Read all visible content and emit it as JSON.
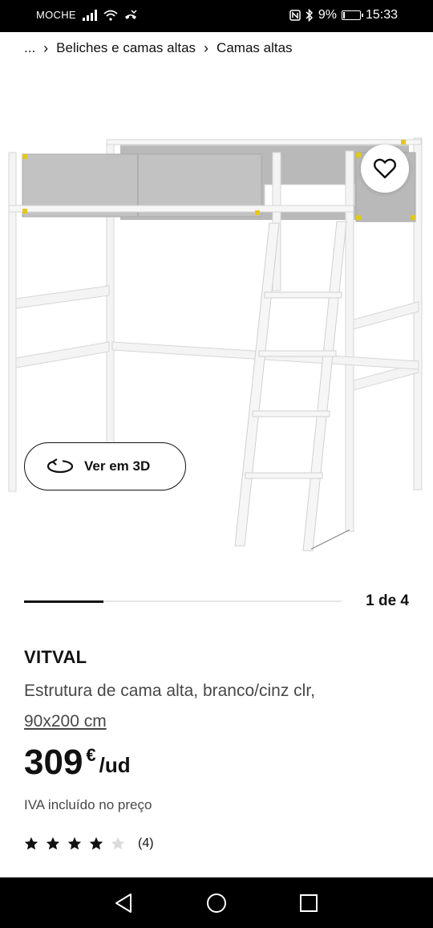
{
  "status_bar": {
    "carrier": "MOCHE",
    "battery": "9%",
    "battery_level": 0.09,
    "time": "15:33"
  },
  "breadcrumb": {
    "items": [
      "...",
      "Beliches e camas altas",
      "Camas altas"
    ]
  },
  "product_image": {
    "alt": "VITVAL"
  },
  "actions": {
    "view_3d_label": "Ver em 3D"
  },
  "gallery": {
    "counter": "1 de 4",
    "progress": 0.25
  },
  "product": {
    "name": "VITVAL",
    "description": "Estrutura de cama alta, branco/cinz clr,",
    "size": "90x200 cm",
    "price_integer": "309",
    "currency": "€",
    "unit": "/ud",
    "vat_note": "IVA incluído no preço",
    "rating_value": 4,
    "rating_max": 5,
    "review_count": "(4)"
  },
  "colors": {
    "frame": "#f5f5f5",
    "panel": "#bdbdbd",
    "accent": "#e4c817",
    "text": "#111111",
    "muted": "#484848"
  }
}
